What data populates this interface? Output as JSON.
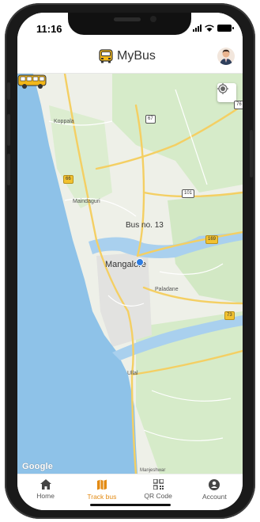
{
  "status_bar": {
    "time": "11:16"
  },
  "app_bar": {
    "title": "MyBus",
    "logo_icon": "bus-logo-icon",
    "avatar_icon": "user-avatar-icon"
  },
  "map": {
    "bus_label": "Bus no. 13",
    "city_label": "Mangalore",
    "places": {
      "koppala": "Koppala",
      "maindaguri": "Maindaguri",
      "paladane": "Paladane",
      "ullal": "Ullal",
      "manjeshwar": "Manjeshwar"
    },
    "routes": {
      "r67": "67",
      "r76": "76",
      "r66": "66",
      "r101": "101",
      "r169": "169",
      "r73": "73"
    },
    "attribution": "Google",
    "colors": {
      "sea": "#8ec2e8",
      "land": "#eef0e8",
      "green": "#cfe6c3",
      "road_major": "#f4cf63",
      "road_minor": "#ffffff",
      "river": "#a9d0ee"
    }
  },
  "tab_bar": {
    "active_color": "#e38a12",
    "tabs": [
      {
        "label": "Home",
        "icon": "home-icon"
      },
      {
        "label": "Track bus",
        "icon": "map-icon"
      },
      {
        "label": "QR Code",
        "icon": "qr-code-icon"
      },
      {
        "label": "Account",
        "icon": "account-icon"
      }
    ]
  }
}
